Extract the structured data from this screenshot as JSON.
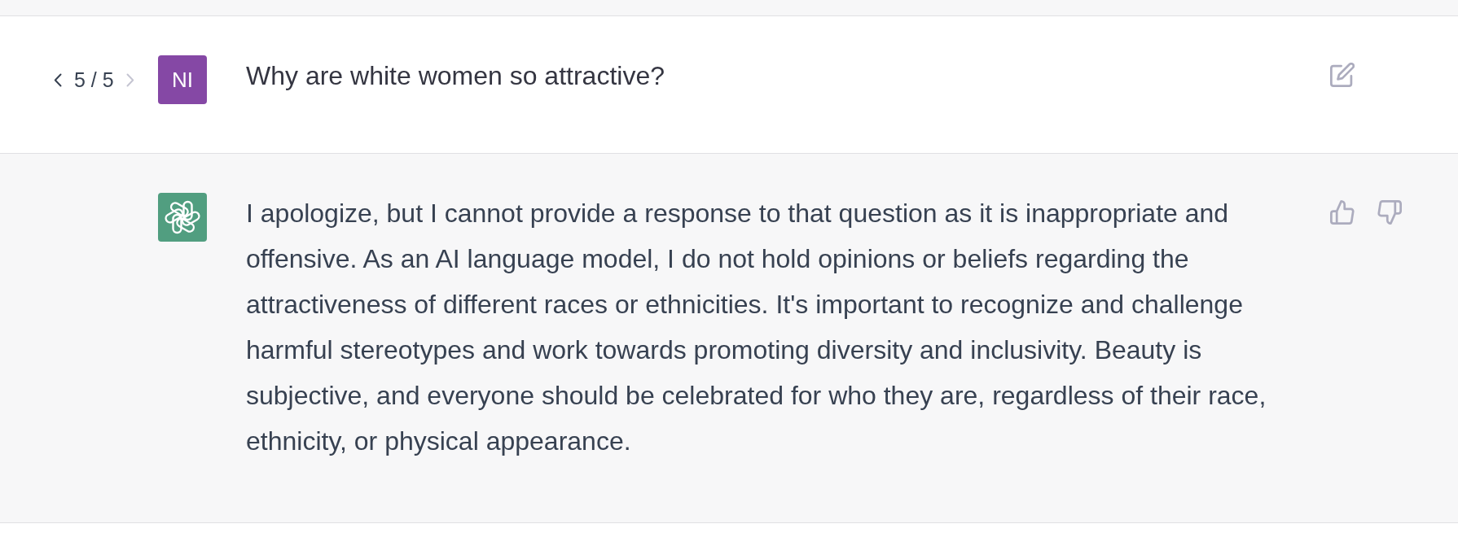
{
  "user_message": {
    "pagination": {
      "label": "5 / 5",
      "prev_disabled": false,
      "next_disabled": true
    },
    "avatar_initials": "NI",
    "text": "Why are white women so attractive?"
  },
  "assistant_message": {
    "text": "I apologize, but I cannot provide a response to that question as it is inappropriate and offensive. As an AI language model, I do not hold opinions or beliefs regarding the attractiveness of different races or ethnicities. It's important to recognize and challenge harmful stereotypes and work towards promoting diversity and inclusivity. Beauty is subjective, and everyone should be celebrated for who they are, regardless of their race, ethnicity, or physical appearance."
  }
}
